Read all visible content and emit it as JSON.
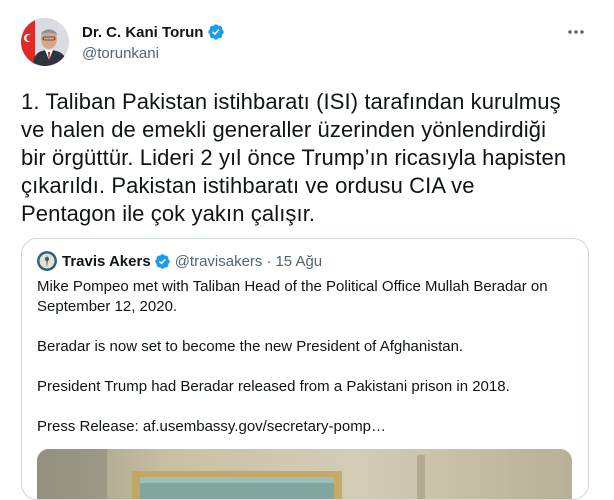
{
  "author": {
    "display_name": "Dr. C. Kani Torun",
    "handle": "@torunkani",
    "verified": true
  },
  "more_icon": "more-horizontal-icon",
  "tweet_lines": [
    "1. Taliban Pakistan istihbaratı (ISI) tarafından kurulmuş",
    "ve halen de emekli generaller üzerinden yönlendirdiği",
    "bir örgüttür. Lideri 2 yıl önce Trump’ın ricasıyla hapisten",
    "çıkarıldı. Pakistan istihbaratı ve ordusu CIA ve",
    "Pentagon ile çok yakın çalışır."
  ],
  "quoted": {
    "display_name": "Travis Akers",
    "handle": "@travisakers",
    "separator": "·",
    "date": "15 Ağu",
    "verified": true,
    "body_lines": [
      "Mike Pompeo met with Taliban Head of the Political Office Mullah Beradar on",
      "September 12, 2020.",
      "",
      "Beradar is now set to become the new President of Afghanistan.",
      "",
      "President Trump had Beradar released from a Pakistani prison in 2018.",
      "",
      "Press Release: af.usembassy.gov/secretary-pomp…"
    ]
  },
  "colors": {
    "verified": "#1d9bf0",
    "text_primary": "#0f1419",
    "text_secondary": "#536471",
    "border": "#cfd9de"
  }
}
